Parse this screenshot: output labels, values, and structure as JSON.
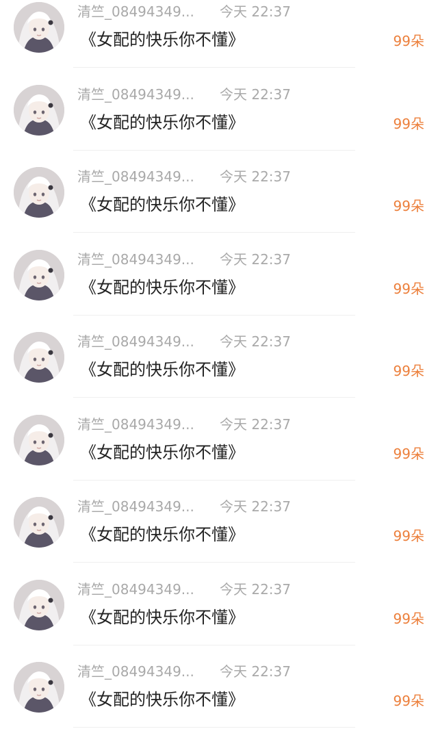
{
  "rows": [
    {
      "user": "清竺_08494349...",
      "time": "今天 22:37",
      "title": "《女配的快乐你不懂》",
      "count": "99朵"
    },
    {
      "user": "清竺_08494349...",
      "time": "今天 22:37",
      "title": "《女配的快乐你不懂》",
      "count": "99朵"
    },
    {
      "user": "清竺_08494349...",
      "time": "今天 22:37",
      "title": "《女配的快乐你不懂》",
      "count": "99朵"
    },
    {
      "user": "清竺_08494349...",
      "time": "今天 22:37",
      "title": "《女配的快乐你不懂》",
      "count": "99朵"
    },
    {
      "user": "清竺_08494349...",
      "time": "今天 22:37",
      "title": "《女配的快乐你不懂》",
      "count": "99朵"
    },
    {
      "user": "清竺_08494349...",
      "time": "今天 22:37",
      "title": "《女配的快乐你不懂》",
      "count": "99朵"
    },
    {
      "user": "清竺_08494349...",
      "time": "今天 22:37",
      "title": "《女配的快乐你不懂》",
      "count": "99朵"
    },
    {
      "user": "清竺_08494349...",
      "time": "今天 22:37",
      "title": "《女配的快乐你不懂》",
      "count": "99朵"
    },
    {
      "user": "清竺_08494349...",
      "time": "今天 22:37",
      "title": "《女配的快乐你不懂》",
      "count": "99朵"
    }
  ],
  "colors": {
    "meta_text": "#a9a9a9",
    "title_text": "#222222",
    "count_accent": "#ec7f3b",
    "divider": "#efefef"
  },
  "icons": {
    "avatar": "anime-girl-avatar"
  }
}
